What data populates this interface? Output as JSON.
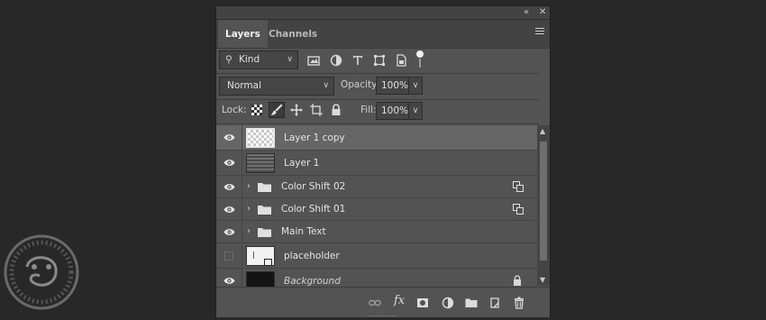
{
  "panel": {
    "tabs": [
      {
        "label": "Layers",
        "active": true
      },
      {
        "label": "Channels",
        "active": false
      }
    ]
  },
  "filter": {
    "kind_label": "Kind",
    "icons": [
      "image-filter-icon",
      "adjustment-filter-icon",
      "type-filter-icon",
      "shape-filter-icon",
      "smart-object-filter-icon",
      "filter-toggle-icon"
    ]
  },
  "blend": {
    "mode": "Normal",
    "opacity_label": "Opacity:",
    "opacity_value": "100%"
  },
  "lock": {
    "label": "Lock:",
    "fill_label": "Fill:",
    "fill_value": "100%",
    "icons": [
      "lock-transparent-pixels-icon",
      "lock-image-pixels-icon",
      "lock-position-icon",
      "lock-artboard-icon",
      "lock-all-icon"
    ]
  },
  "layers": [
    {
      "name": "Layer 1 copy",
      "type": "pixel",
      "visible": true,
      "selected": true
    },
    {
      "name": "Layer 1",
      "type": "pixel",
      "visible": true,
      "selected": false
    },
    {
      "name": "Color Shift 02",
      "type": "group",
      "visible": true,
      "selected": false,
      "badge": "smart-object-icon"
    },
    {
      "name": "Color Shift 01",
      "type": "group",
      "visible": true,
      "selected": false,
      "badge": "smart-object-icon"
    },
    {
      "name": "Main Text",
      "type": "group",
      "visible": true,
      "selected": false
    },
    {
      "name": "placeholder",
      "type": "smart",
      "visible": false,
      "selected": false
    },
    {
      "name": "Background",
      "type": "background",
      "visible": true,
      "selected": false,
      "badge": "lock-icon"
    }
  ],
  "footer": {
    "icons": [
      "link-layers-icon",
      "fx-icon",
      "add-mask-icon",
      "new-adjustment-icon",
      "new-group-icon",
      "new-layer-icon",
      "delete-layer-icon"
    ],
    "fx_label": "fx"
  }
}
